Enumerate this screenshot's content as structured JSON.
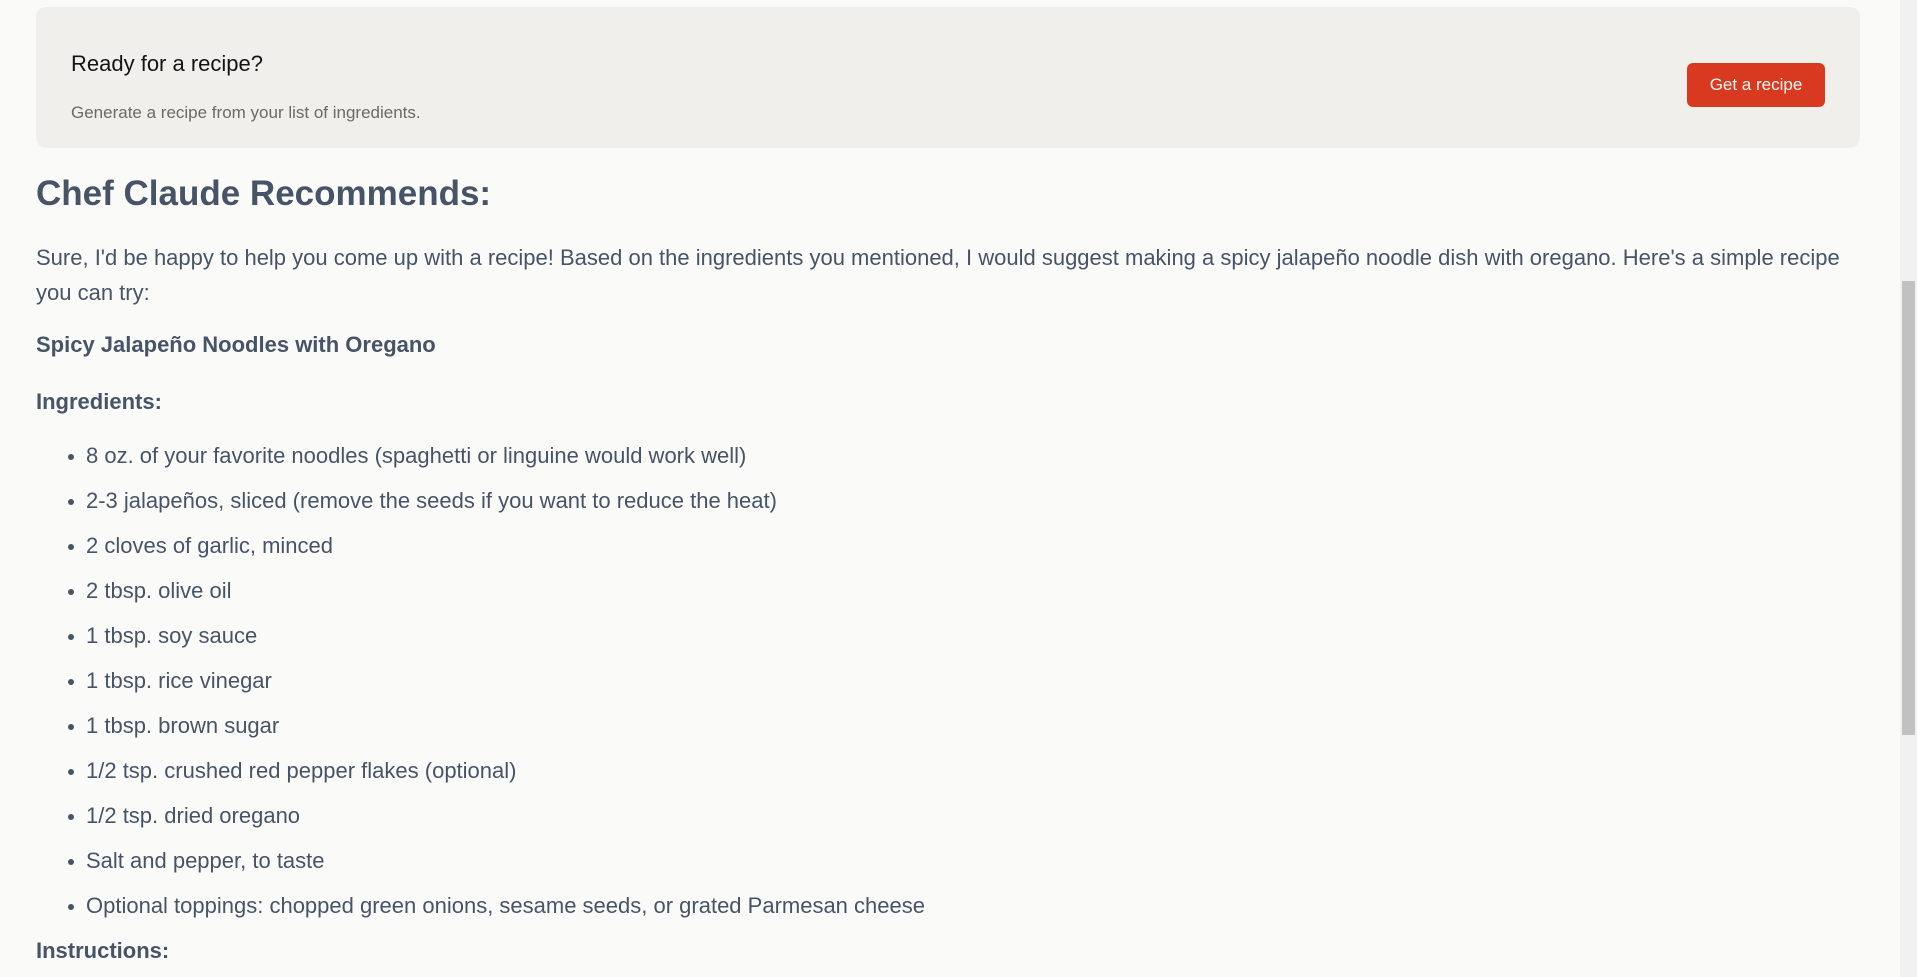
{
  "cta": {
    "title": "Ready for a recipe?",
    "subtitle": "Generate a recipe from your list of ingredients.",
    "button_label": "Get a recipe",
    "button_color": "#d93a1f"
  },
  "recipe": {
    "heading": "Chef Claude Recommends:",
    "intro": "Sure, I'd be happy to help you come up with a recipe! Based on the ingredients you mentioned, I would suggest making a spicy jalapeño noodle dish with oregano. Here's a simple recipe you can try:",
    "dish_name": "Spicy Jalapeño Noodles with Oregano",
    "ingredients_heading": "Ingredients:",
    "ingredients": [
      "8 oz. of your favorite noodles (spaghetti or linguine would work well)",
      "2-3 jalapeños, sliced (remove the seeds if you want to reduce the heat)",
      "2 cloves of garlic, minced",
      "2 tbsp. olive oil",
      "1 tbsp. soy sauce",
      "1 tbsp. rice vinegar",
      "1 tbsp. brown sugar",
      "1/2 tsp. crushed red pepper flakes (optional)",
      "1/2 tsp. dried oregano",
      "Salt and pepper, to taste",
      "Optional toppings: chopped green onions, sesame seeds, or grated Parmesan cheese"
    ],
    "instructions_heading": "Instructions:"
  },
  "colors": {
    "page_background": "#fafaf8",
    "panel_background": "#f0efeb",
    "recipe_text": "#475467"
  }
}
